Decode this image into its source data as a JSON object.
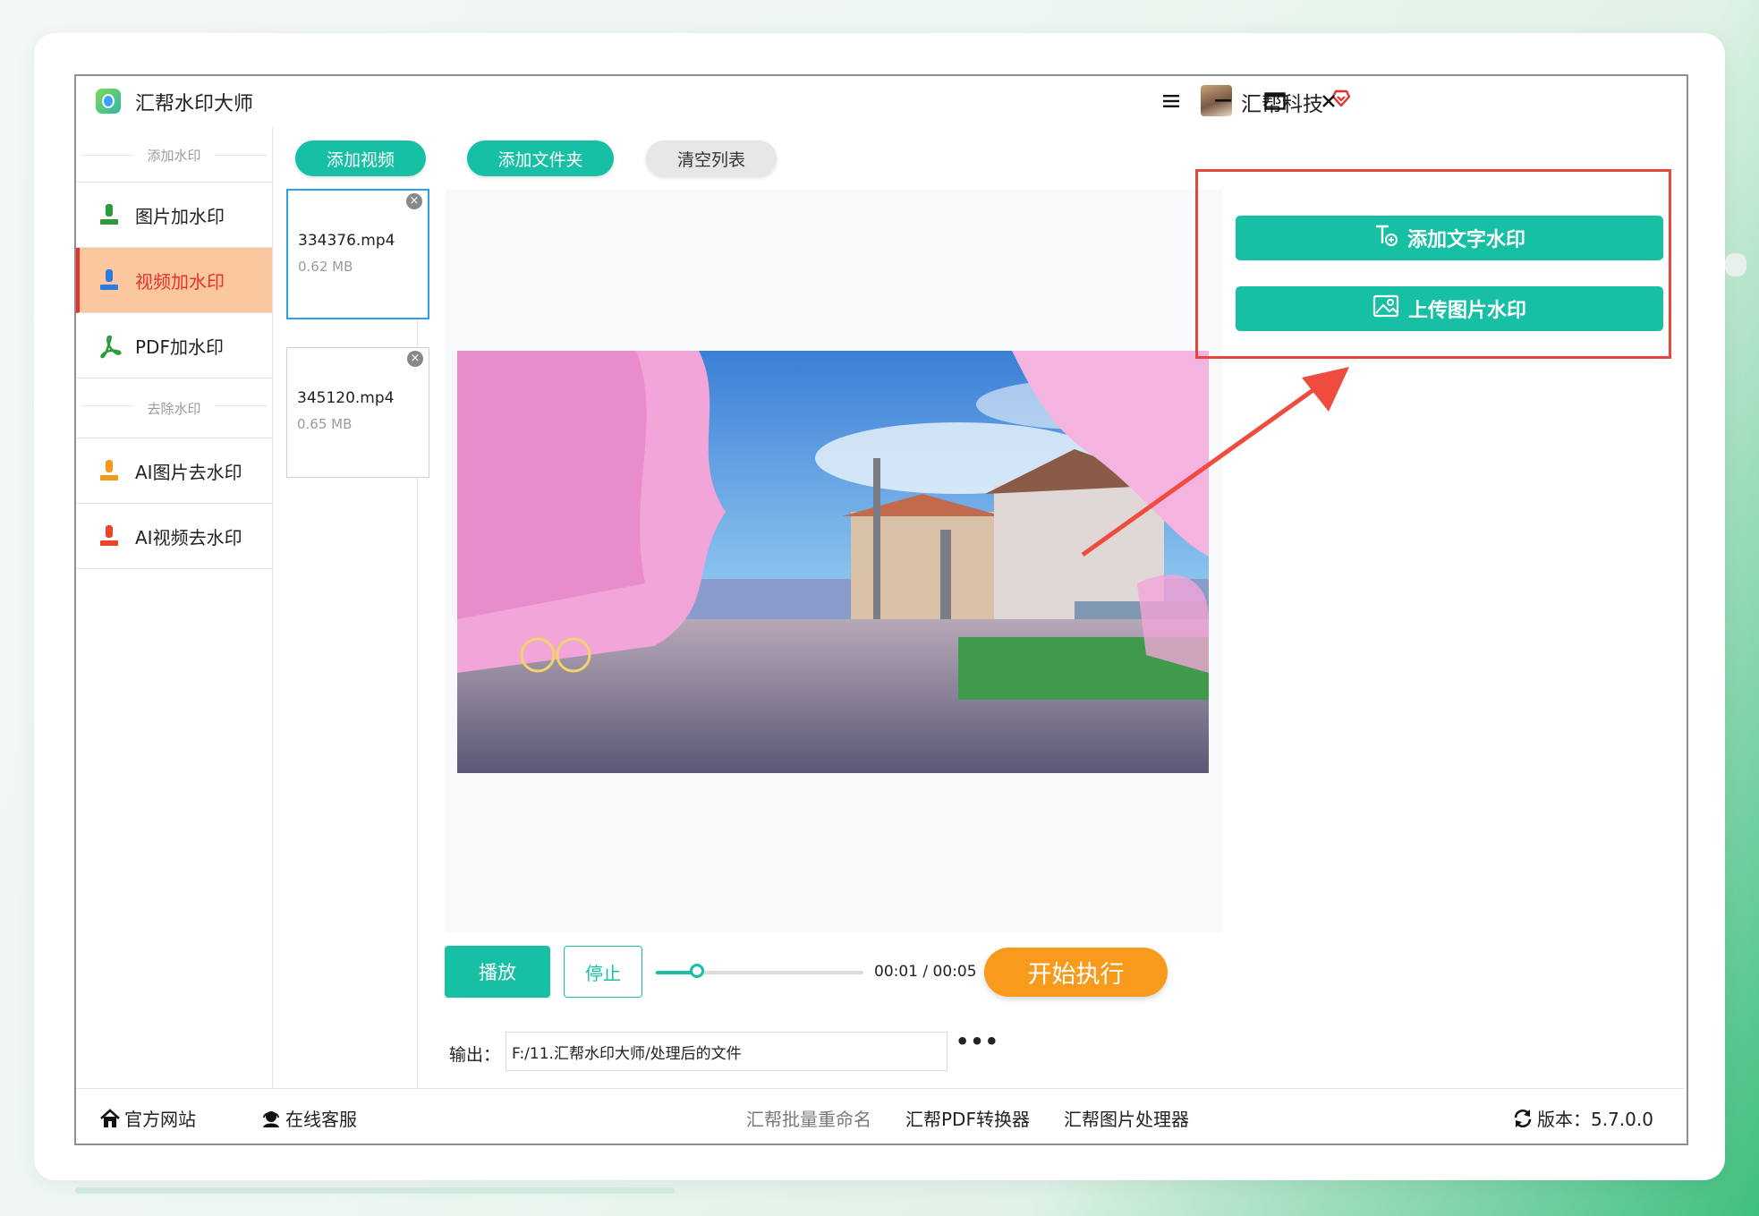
{
  "window": {
    "title": "汇帮水印大师",
    "company": "汇帮科技"
  },
  "sidebar": {
    "add_section": "添加水印",
    "add_items": [
      {
        "label": "图片加水印",
        "color": "#2e9b3a"
      },
      {
        "label": "视频加水印",
        "color": "#2d7be0"
      },
      {
        "label": "PDF加水印",
        "color": "#2e9b3a"
      }
    ],
    "remove_section": "去除水印",
    "remove_items": [
      {
        "label": "AI图片去水印",
        "color": "#f39a1c"
      },
      {
        "label": "AI视频去水印",
        "color": "#e8452b"
      }
    ]
  },
  "toolbar": {
    "add_video": "添加视频",
    "add_folder": "添加文件夹",
    "clear_list": "清空列表"
  },
  "files": [
    {
      "name": "334376.mp4",
      "size": "0.62 MB"
    },
    {
      "name": "345120.mp4",
      "size": "0.65 MB"
    }
  ],
  "watermark": {
    "add_text": "添加文字水印",
    "upload_image": "上传图片水印"
  },
  "player": {
    "play": "播放",
    "stop": "停止",
    "time": "00:01 / 00:05",
    "progress": 0.2,
    "start": "开始执行"
  },
  "output": {
    "label": "输出：",
    "path": "F:/11.汇帮水印大师/处理后的文件",
    "more": "•••"
  },
  "bottom": {
    "website": "官方网站",
    "support": "在线客服",
    "links": [
      "汇帮批量重命名",
      "汇帮PDF转换器",
      "汇帮图片处理器"
    ],
    "version": "版本：5.7.0.0"
  },
  "colors": {
    "accent": "#17bfa5",
    "orange": "#f89a1c",
    "active_bg": "#fbc79f",
    "active_text": "#e8312f",
    "highlight_border": "#e8453c"
  }
}
